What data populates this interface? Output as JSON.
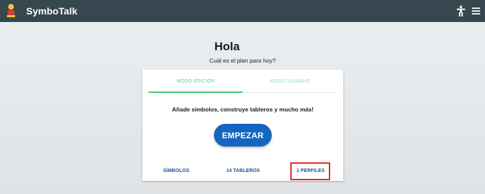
{
  "appbar": {
    "title": "SymboTalk",
    "logo_icon": "symbotalk-logo-icon",
    "accessibility_icon": "accessibility-icon",
    "menu_icon": "hamburger-menu-icon",
    "background": "#37474f"
  },
  "main": {
    "greeting": "Hola",
    "subtitle": "Cuál es el plan para hoy?"
  },
  "card": {
    "tabs": [
      {
        "label": "MODO EDICIÓN",
        "active": true
      },
      {
        "label": "MODO USUARIO",
        "active": false
      }
    ],
    "message": "Añade símbolos, construye tableros y mucho más!",
    "start_button": "EMPEZAR",
    "footer_links": {
      "symbols": "SÍMBOLOS",
      "boards": "14 TABLEROS",
      "profiles": "1 PERFILES"
    }
  },
  "colors": {
    "accent_green": "#3dca6e",
    "primary_button": "#1565c0",
    "link_blue": "#1f4f8f",
    "highlight_red": "#e32626"
  }
}
